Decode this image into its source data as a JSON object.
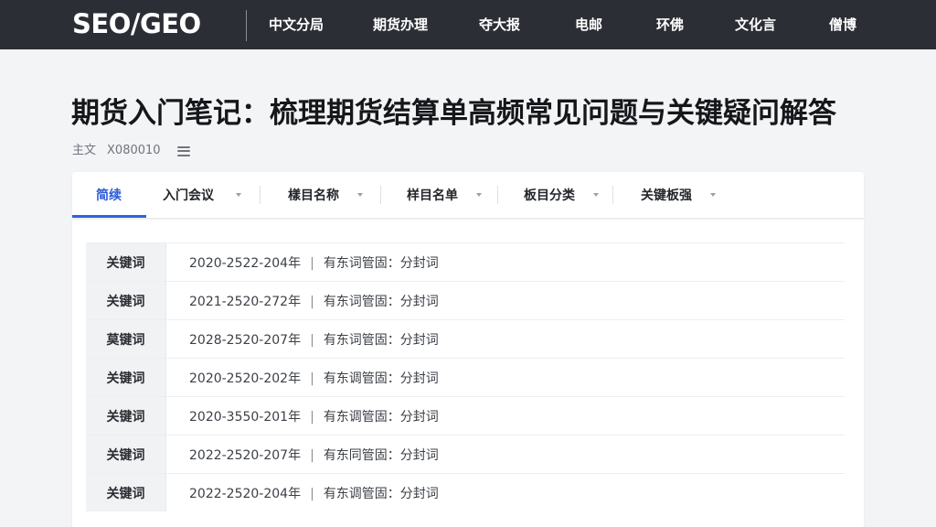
{
  "header": {
    "brand": "SEO/GEO",
    "nav": [
      "中文分局",
      "期货办理",
      "夺大报",
      "电邮",
      "环佛",
      "文化言",
      "僧博"
    ]
  },
  "article": {
    "title": "期货入门笔记：梳理期货结算单高频常见问题与关键疑问解答",
    "meta_author": "主文",
    "meta_code": "X080010"
  },
  "tabs": [
    {
      "label": "简续",
      "active": true,
      "dropdown": false
    },
    {
      "label": "入门会议",
      "active": false,
      "dropdown": true
    },
    {
      "label": "樣目名称",
      "active": false,
      "dropdown": true
    },
    {
      "label": "样目名单",
      "active": false,
      "dropdown": true
    },
    {
      "label": "板目分类",
      "active": false,
      "dropdown": true
    },
    {
      "label": "关键板强",
      "active": false,
      "dropdown": true
    }
  ],
  "rows": [
    {
      "label": "关键词",
      "range": "2020-2522-204年",
      "desc": "有东词管固：分封词"
    },
    {
      "label": "关键词",
      "range": "2021-2520-272年",
      "desc": "有东词管固：分封词"
    },
    {
      "label": "莫键词",
      "range": "2028-2520-207年",
      "desc": "有东词管固：分封词"
    },
    {
      "label": "关键词",
      "range": "2020-2520-202年",
      "desc": "有东调管固：分封词"
    },
    {
      "label": "关键词",
      "range": "2020-3550-201年",
      "desc": "有东调管固：分封词"
    },
    {
      "label": "关键词",
      "range": "2022-2520-207年",
      "desc": "有东同管固：分封词"
    },
    {
      "label": "关键词",
      "range": "2022-2520-204年",
      "desc": "有东调管固：分封词"
    }
  ],
  "colors": {
    "topbar": "#2b2e35",
    "accent": "#2f62e0",
    "page_bg": "#f3f4f6"
  }
}
